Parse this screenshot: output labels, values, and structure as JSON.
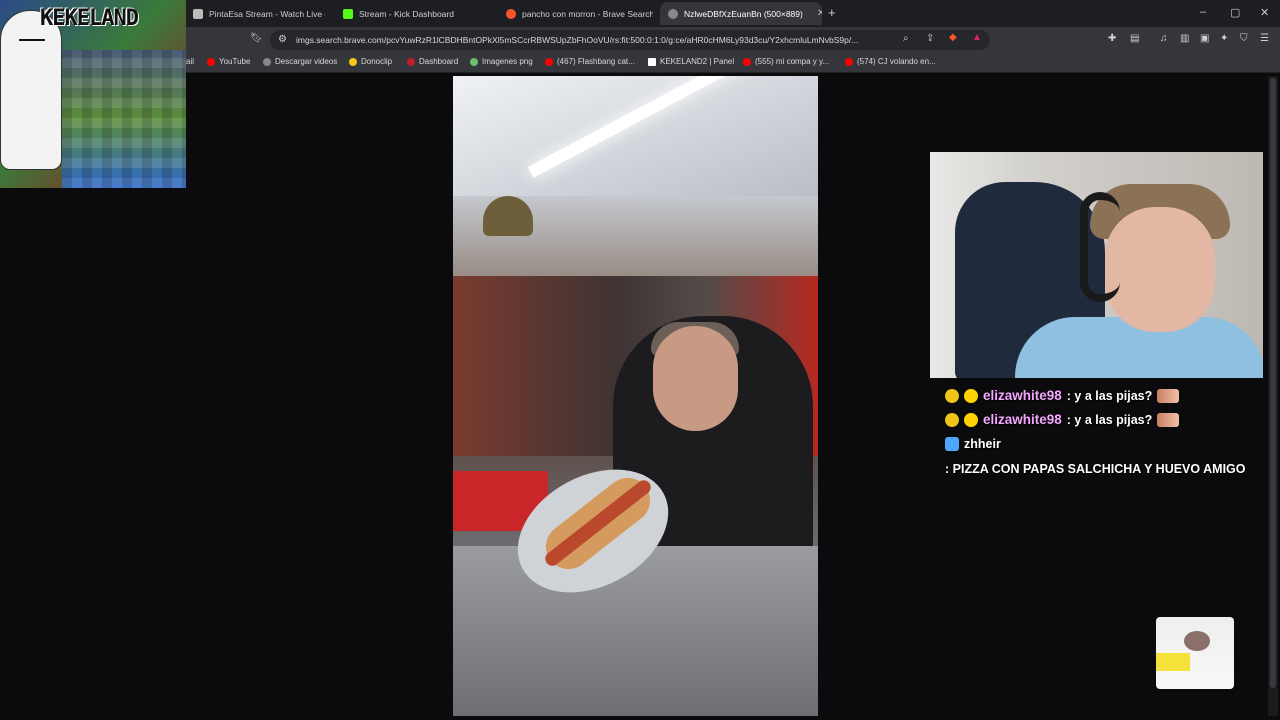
{
  "browser": {
    "tabs": [
      {
        "title": "PintaEsa Stream - Watch Live on",
        "icon": "muted-speaker-icon",
        "active": false
      },
      {
        "title": "Stream - Kick Dashboard",
        "icon": "kick-logo-icon",
        "active": false
      },
      {
        "title": "pancho con morron - Brave Search",
        "icon": "brave-search-icon",
        "active": false
      },
      {
        "title": "NzlweDBfXzEuanBn (500×889)",
        "icon": "globe-icon",
        "active": true
      }
    ],
    "url": "imgs.search.brave.com/pcvYuwRzR1lCBDHBntOPkXl5mSCcrRBWSUpZbFhOoVU/rs:fit:500:0:1:0/g:ce/aHR0cHM6Ly93d3cu/Y2xhcmluLmNvbS9p/...",
    "bookmarks": [
      {
        "label": "ail",
        "icon": "mail-icon"
      },
      {
        "label": "YouTube",
        "icon": "youtube-icon"
      },
      {
        "label": "Descargar videos",
        "icon": "download-icon"
      },
      {
        "label": "Donoclip",
        "icon": "donoclip-icon"
      },
      {
        "label": "Dashboard",
        "icon": "dashboard-icon"
      },
      {
        "label": "Imagenes png",
        "icon": "image-icon"
      },
      {
        "label": "(467) Flashbang cat...",
        "icon": "youtube-icon"
      },
      {
        "label": "KEKELAND2 | Panel",
        "icon": "panel-icon"
      },
      {
        "label": "(555) mi compa y y...",
        "icon": "youtube-icon"
      },
      {
        "label": "(574) CJ volando en...",
        "icon": "youtube-icon"
      }
    ]
  },
  "overlay": {
    "brand": "KEKELAND"
  },
  "chat": [
    {
      "user": "elizawhite98",
      "text": ": y a las pijas?",
      "badges": [
        "sub-badge-icon",
        "info-badge-icon"
      ],
      "emote": true
    },
    {
      "user": "elizawhite98",
      "text": ": y a las pijas?",
      "badges": [
        "sub-badge-icon",
        "info-badge-icon"
      ],
      "emote": true
    },
    {
      "user": "zhheir",
      "text": ": PIZZA CON PAPAS SALCHICHA Y HUEVO AMIGO",
      "badges": [
        "prime-badge-icon"
      ],
      "emote": false
    }
  ],
  "colors": {
    "chat_user_pink": "#f3a6ff",
    "tab_bg": "#1d1e22",
    "toolbar_bg": "#35363b",
    "page_bg": "#0b0b0d"
  }
}
